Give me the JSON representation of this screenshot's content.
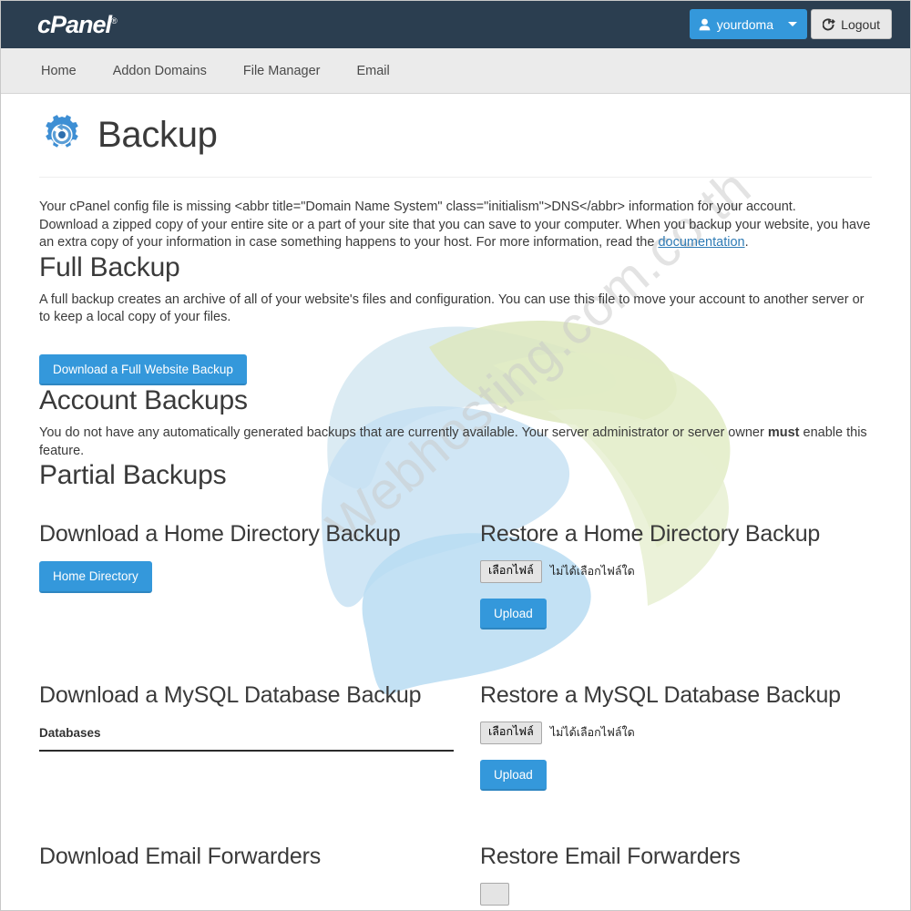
{
  "header": {
    "logo_text": "cPanel",
    "logo_tm": "®",
    "account_label": "yourdoma",
    "account_icon": "user-icon",
    "caret_icon": "chevron-down-icon",
    "logout_label": "Logout",
    "logout_icon": "logout-icon",
    "accent_blue": "#3498db",
    "bar_color": "#2b3e50"
  },
  "nav": {
    "items": [
      {
        "label": "Home"
      },
      {
        "label": "Addon Domains"
      },
      {
        "label": "File Manager"
      },
      {
        "label": "Email"
      }
    ]
  },
  "page": {
    "title": "Backup",
    "title_icon": "backup-gear-icon",
    "intro_line1": "Your cPanel config file is missing <abbr title=\"Domain Name System\" class=\"initialism\">DNS</abbr> information for your account.",
    "intro_line2_before": "Download a zipped copy of your entire site or a part of your site that you can save to your computer. When you backup your website, you have an extra copy of your information in case something happens to your host. For more information, read the ",
    "intro_link": "documentation",
    "intro_line2_after": "."
  },
  "full_backup": {
    "heading": "Full Backup",
    "description": "A full backup creates an archive of all of your website's files and configuration. You can use this file to move your account to another server or to keep a local copy of your files.",
    "button_label": "Download a Full Website Backup"
  },
  "account_backups": {
    "heading": "Account Backups",
    "text_before": "You do not have any automatically generated backups that are currently available. Your server administrator or server owner ",
    "text_bold": "must",
    "text_after": " enable this feature."
  },
  "partial_backups": {
    "heading": "Partial Backups",
    "rows": [
      {
        "download_heading": "Download a Home Directory Backup",
        "download_button": "Home Directory",
        "restore_heading": "Restore a Home Directory Backup",
        "file_button": "เลือกไฟล์",
        "file_status": "ไม่ได้เลือกไฟล์ใด",
        "upload_button": "Upload"
      },
      {
        "download_heading": "Download a MySQL Database Backup",
        "download_field_label": "Databases",
        "restore_heading": "Restore a MySQL Database Backup",
        "file_button": "เลือกไฟล์",
        "file_status": "ไม่ได้เลือกไฟล์ใด",
        "upload_button": "Upload"
      },
      {
        "download_heading": "Download Email Forwarders",
        "restore_heading": "Restore Email Forwarders"
      }
    ]
  },
  "watermark": {
    "text": "Webhosting.com.co.th"
  }
}
